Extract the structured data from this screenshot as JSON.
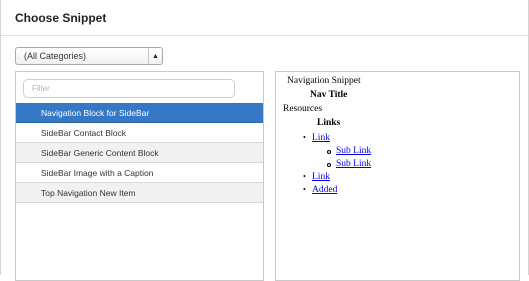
{
  "dialog": {
    "title": "Choose Snippet"
  },
  "category_select": {
    "value": "(All Categories)"
  },
  "filter": {
    "placeholder": "Filter"
  },
  "snippets": [
    "Navigation Block for SideBar",
    "SideBar Contact Block",
    "SideBar Generic Content Block",
    "SideBar Image with a Caption",
    "Top Navigation New Item"
  ],
  "selected_index": 0,
  "preview": {
    "heading": "Navigation Snippet",
    "nav_title": "Nav Title",
    "resources": "Resources",
    "links_heading": "Links",
    "link_1": "Link",
    "sub_link_1": "Sub Link",
    "sub_link_2": "Sub Link",
    "link_2": "Link",
    "added": "Added"
  },
  "colors": {
    "selected_bg": "#3478c6",
    "link": "#0000ee"
  }
}
